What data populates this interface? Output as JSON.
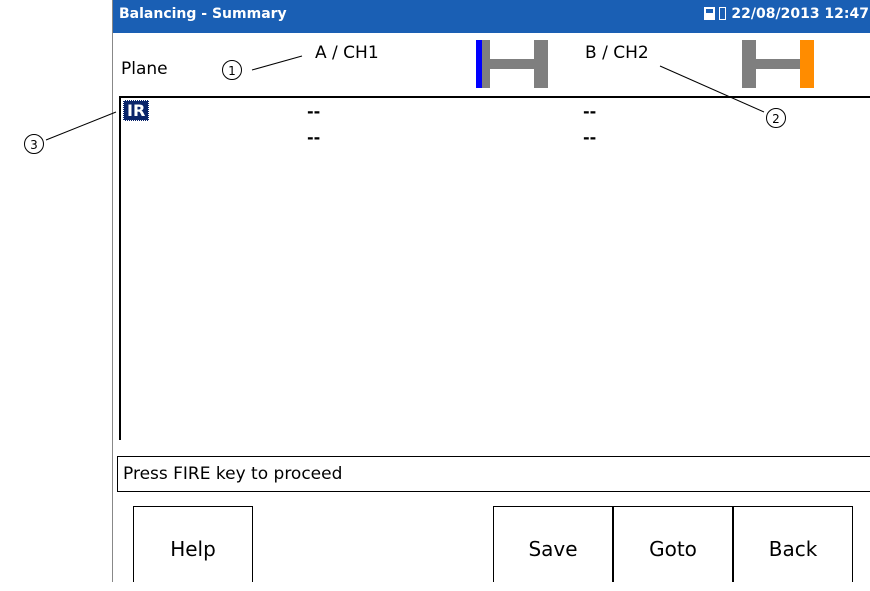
{
  "window": {
    "title": "Balancing - Summary",
    "datetime": "22/08/2013 12:47",
    "icons": [
      "sd-card-icon",
      "battery-icon"
    ]
  },
  "header": {
    "plane_label": "Plane",
    "channel_a": "A / CH1",
    "channel_b": "B / CH2"
  },
  "rotor_colors": {
    "plane_a_highlight": "#0000ff",
    "plane_b_highlight": "#ff8c00",
    "body": "#7f7f7f"
  },
  "table": {
    "rows": [
      {
        "label": "IR",
        "a": "--",
        "b": "--"
      },
      {
        "label": "",
        "a": "--",
        "b": "--"
      }
    ]
  },
  "status_message": "Press FIRE key to proceed",
  "softkeys": {
    "help": "Help",
    "save": "Save",
    "goto": "Goto",
    "back": "Back"
  },
  "callouts": [
    "1",
    "2",
    "3"
  ],
  "colors": {
    "titlebar": "#1a5fb4",
    "selection": "#0a246a"
  }
}
